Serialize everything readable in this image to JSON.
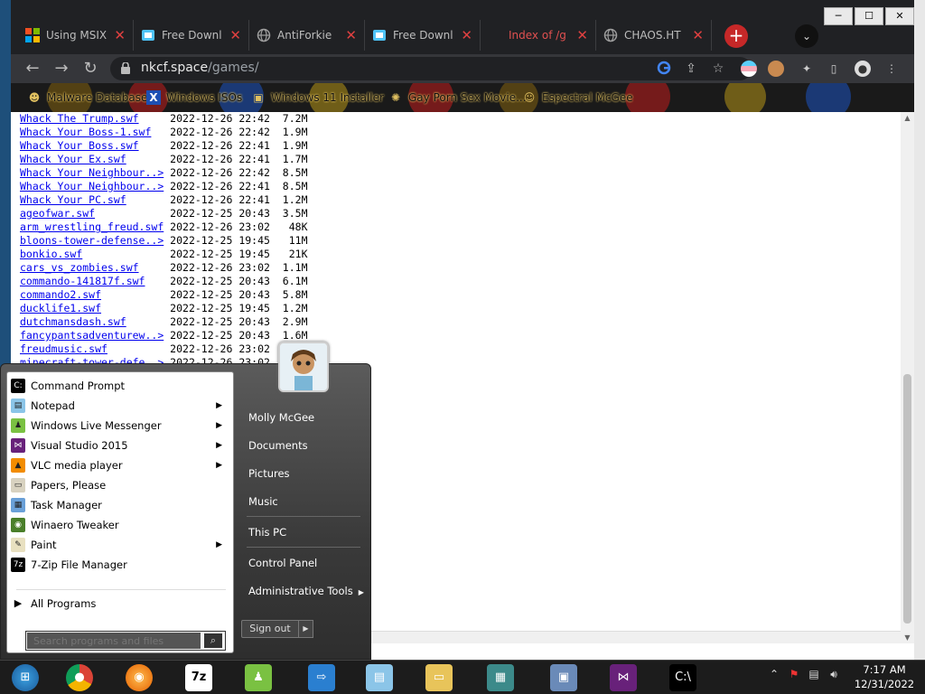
{
  "window": {
    "minimize": "─",
    "maximize": "☐",
    "close": "✕"
  },
  "tabs": [
    {
      "title": "Using MSIX",
      "favicon": "office-icon",
      "color": "#f25022"
    },
    {
      "title": "Free Downl",
      "favicon": "chrome-page-icon",
      "color": "#4fc3f7"
    },
    {
      "title": "AntiForkie",
      "favicon": "globe-icon",
      "color": "#9e9e9e"
    },
    {
      "title": "Free Downl",
      "favicon": "chrome-page-icon",
      "color": "#4fc3f7"
    },
    {
      "title": "Index of /g",
      "favicon": "none",
      "color": "#e05050"
    },
    {
      "title": "CHAOS.HT",
      "favicon": "globe-icon",
      "color": "#9e9e9e"
    }
  ],
  "tab_close_glyph": "✕",
  "new_tab": "+",
  "tab_search": "⌄",
  "nav": {
    "back": "←",
    "forward": "→",
    "reload": "↻"
  },
  "address": {
    "host": "nkcf.space",
    "path": "/games/"
  },
  "bookmarks": [
    {
      "label": "Malware Database",
      "icon": "person-icon"
    },
    {
      "label": "Windows ISOs",
      "icon": "x-logo-icon"
    },
    {
      "label": "Windows 11 Installer",
      "icon": "installer-icon"
    },
    {
      "label": "Gay Porn Sex Movie...",
      "icon": "sparkle-icon"
    },
    {
      "label": "Espectral McGee",
      "icon": "avatar-icon"
    }
  ],
  "files": [
    {
      "name": "Whack The Trump.swf",
      "date": "2022-12-26 22:42",
      "size": "7.2M"
    },
    {
      "name": "Whack Your Boss-1.swf",
      "date": "2022-12-26 22:42",
      "size": "1.9M"
    },
    {
      "name": "Whack Your Boss.swf",
      "date": "2022-12-26 22:41",
      "size": "1.9M"
    },
    {
      "name": "Whack Your Ex.swf",
      "date": "2022-12-26 22:41",
      "size": "1.7M"
    },
    {
      "name": "Whack Your Neighbour..>",
      "date": "2022-12-26 22:42",
      "size": "8.5M"
    },
    {
      "name": "Whack Your Neighbour..>",
      "date": "2022-12-26 22:41",
      "size": "8.5M"
    },
    {
      "name": "Whack Your PC.swf",
      "date": "2022-12-26 22:41",
      "size": "1.2M"
    },
    {
      "name": "ageofwar.swf",
      "date": "2022-12-25 20:43",
      "size": "3.5M"
    },
    {
      "name": "arm_wrestling_freud.swf",
      "date": "2022-12-26 23:02",
      "size": "48K"
    },
    {
      "name": "bloons-tower-defense..>",
      "date": "2022-12-25 19:45",
      "size": "11M"
    },
    {
      "name": "bonkio.swf",
      "date": "2022-12-25 19:45",
      "size": "21K"
    },
    {
      "name": "cars_vs_zombies.swf",
      "date": "2022-12-26 23:02",
      "size": "1.1M"
    },
    {
      "name": "commando-141817f.swf",
      "date": "2022-12-25 20:43",
      "size": "6.1M"
    },
    {
      "name": "commando2.swf",
      "date": "2022-12-25 20:43",
      "size": "5.8M"
    },
    {
      "name": "ducklife1.swf",
      "date": "2022-12-25 19:45",
      "size": "1.2M"
    },
    {
      "name": "dutchmansdash.swf",
      "date": "2022-12-25 20:43",
      "size": "2.9M"
    },
    {
      "name": "fancypantsadventurew..>",
      "date": "2022-12-25 20:43",
      "size": "1.6M"
    },
    {
      "name": "freudmusic.swf",
      "date": "2022-12-26 23:02",
      "size": ""
    },
    {
      "name": "minecraft-tower-defe..>",
      "date": "2022-12-26 23:02",
      "size": ""
    }
  ],
  "start_menu": {
    "programs": [
      {
        "label": "Command Prompt",
        "icon": "cmd-icon",
        "arrow": false
      },
      {
        "label": "Notepad",
        "icon": "notepad-icon",
        "arrow": true
      },
      {
        "label": "Windows Live Messenger",
        "icon": "messenger-icon",
        "arrow": true
      },
      {
        "label": "Visual Studio 2015",
        "icon": "visual-studio-icon",
        "arrow": true
      },
      {
        "label": "VLC media player",
        "icon": "vlc-icon",
        "arrow": true
      },
      {
        "label": "Papers, Please",
        "icon": "papers-icon",
        "arrow": false
      },
      {
        "label": "Task Manager",
        "icon": "task-manager-icon",
        "arrow": false
      },
      {
        "label": "Winaero Tweaker",
        "icon": "winaero-icon",
        "arrow": false
      },
      {
        "label": "Paint",
        "icon": "paint-icon",
        "arrow": true
      },
      {
        "label": "7-Zip File Manager",
        "icon": "7zip-icon",
        "arrow": false
      }
    ],
    "all_programs": "All Programs",
    "search_placeholder": "Search programs and files",
    "user": "Molly McGee",
    "right_items": [
      "Documents",
      "Pictures",
      "Music",
      "This PC",
      "Control Panel",
      "Administrative Tools"
    ],
    "sign_out": "Sign out"
  },
  "taskbar": {
    "apps": [
      "start-orb-icon",
      "chrome-icon",
      "firefox-icon",
      "7zip-icon",
      "messenger-icon",
      "remote-icon",
      "notepad-icon",
      "explorer-icon",
      "blocks-icon",
      "computer-icon",
      "visual-studio-icon",
      "cmd-icon"
    ],
    "time": "7:17 AM",
    "date": "12/31/2022"
  }
}
